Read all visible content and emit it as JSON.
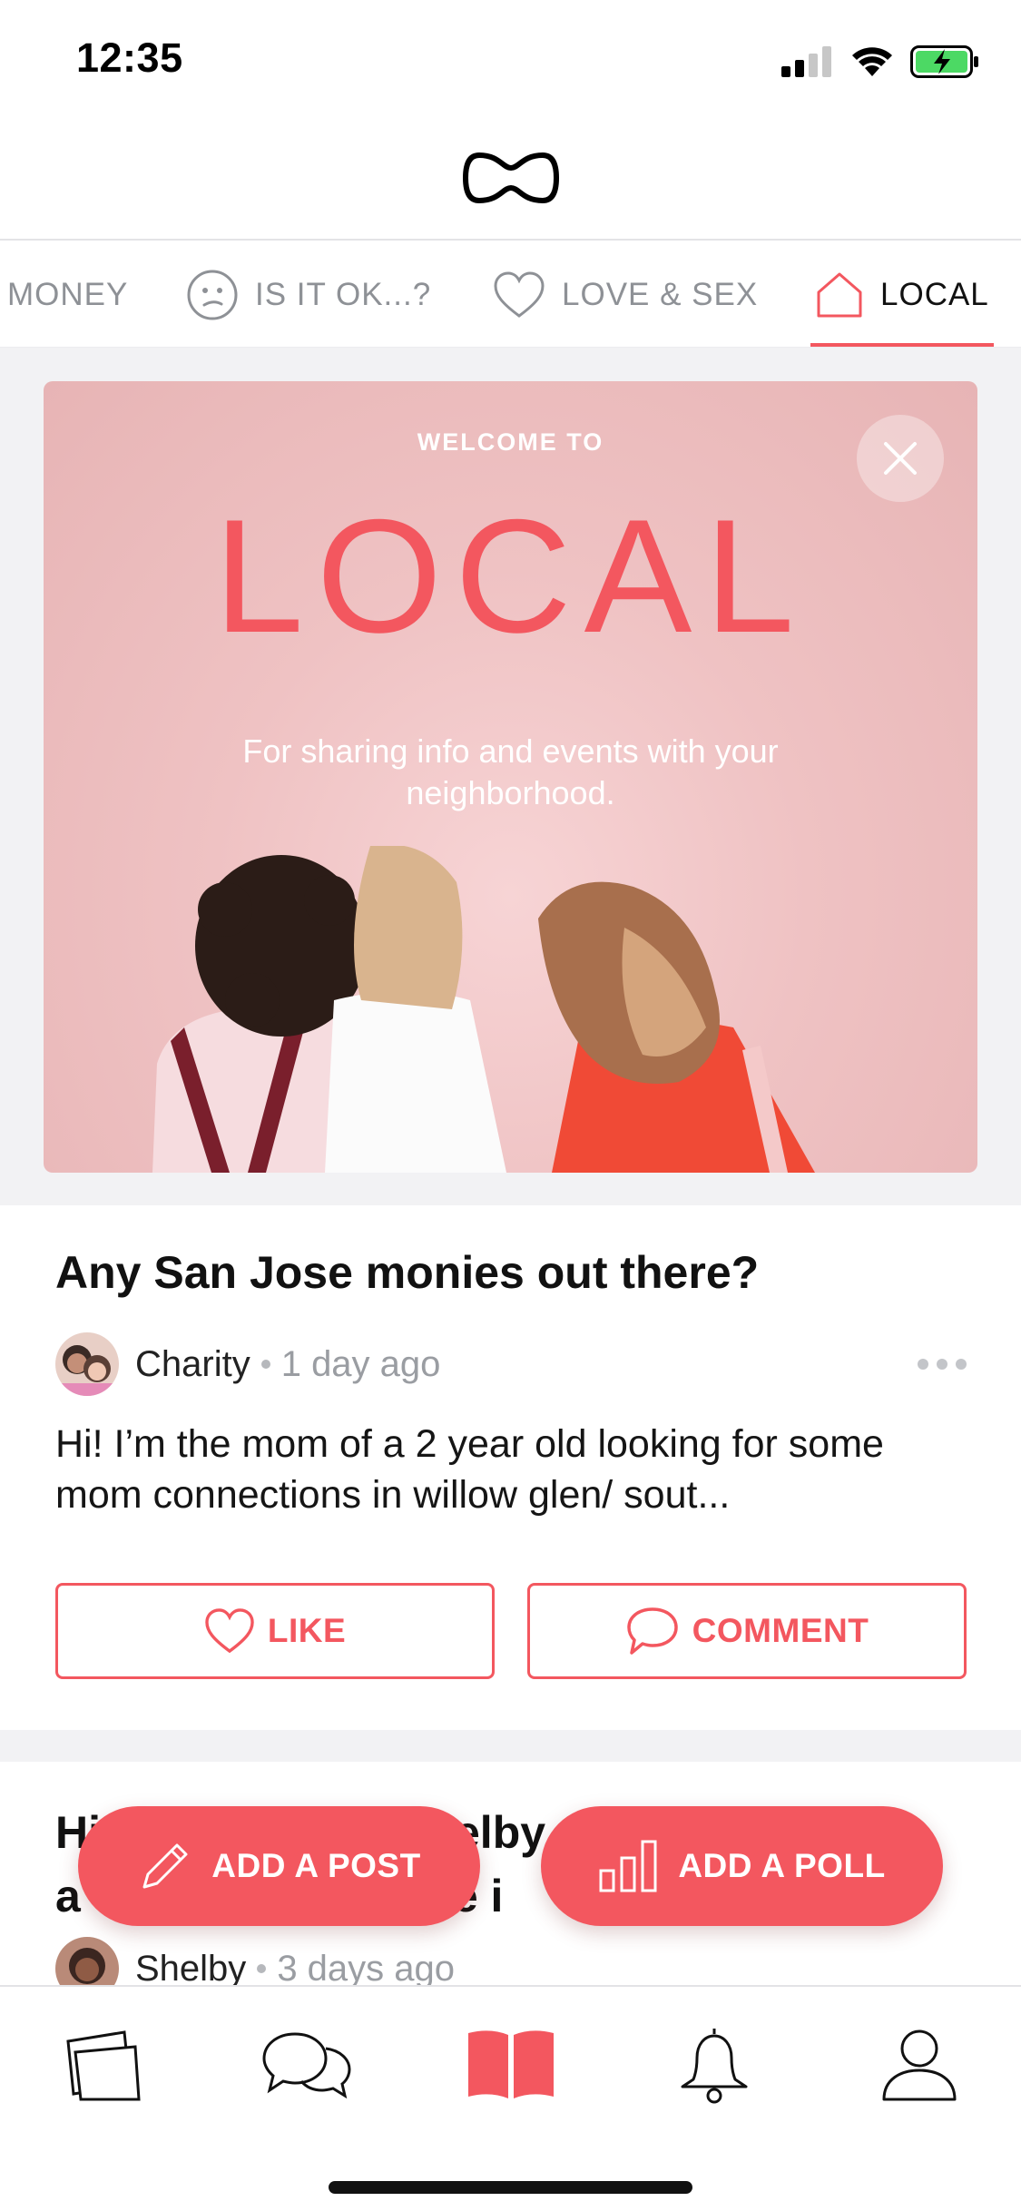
{
  "status_bar": {
    "time": "12:35"
  },
  "header": {
    "logo": "app-logo"
  },
  "tabs": [
    {
      "label": "MONEY",
      "icon": "none"
    },
    {
      "label": "IS IT OK...?",
      "icon": "confused-face-icon"
    },
    {
      "label": "LOVE & SEX",
      "icon": "heart-outline-icon"
    },
    {
      "label": "LOCAL",
      "icon": "house-icon",
      "active": true
    }
  ],
  "welcome": {
    "eyebrow": "WELCOME TO",
    "title": "LOCAL",
    "subtitle": "For sharing info and events with your neighborhood."
  },
  "posts": [
    {
      "title": "Any San Jose monies out there?",
      "author": "Charity",
      "time": "1 day ago",
      "body": "Hi! I’m the mom of a 2 year old looking for some mom connections in willow glen/ sout...",
      "like_label": "LIKE",
      "comment_label": "COMMENT"
    },
    {
      "title_start": "Hi",
      "title_fragment_2": "elby",
      "title_line2_start": "a",
      "title_fragment_4": "e i",
      "author": "Shelby",
      "time": "3 days ago"
    }
  ],
  "fab": {
    "add_post": "ADD A POST",
    "add_poll": "ADD A POLL"
  },
  "bottom_nav": [
    "cards-icon",
    "chat-bubbles-icon",
    "book-icon",
    "bell-icon",
    "profile-icon"
  ],
  "colors": {
    "accent": "#f3575f",
    "card_pink": "#ecbcbd",
    "muted_text": "#8e9196"
  }
}
